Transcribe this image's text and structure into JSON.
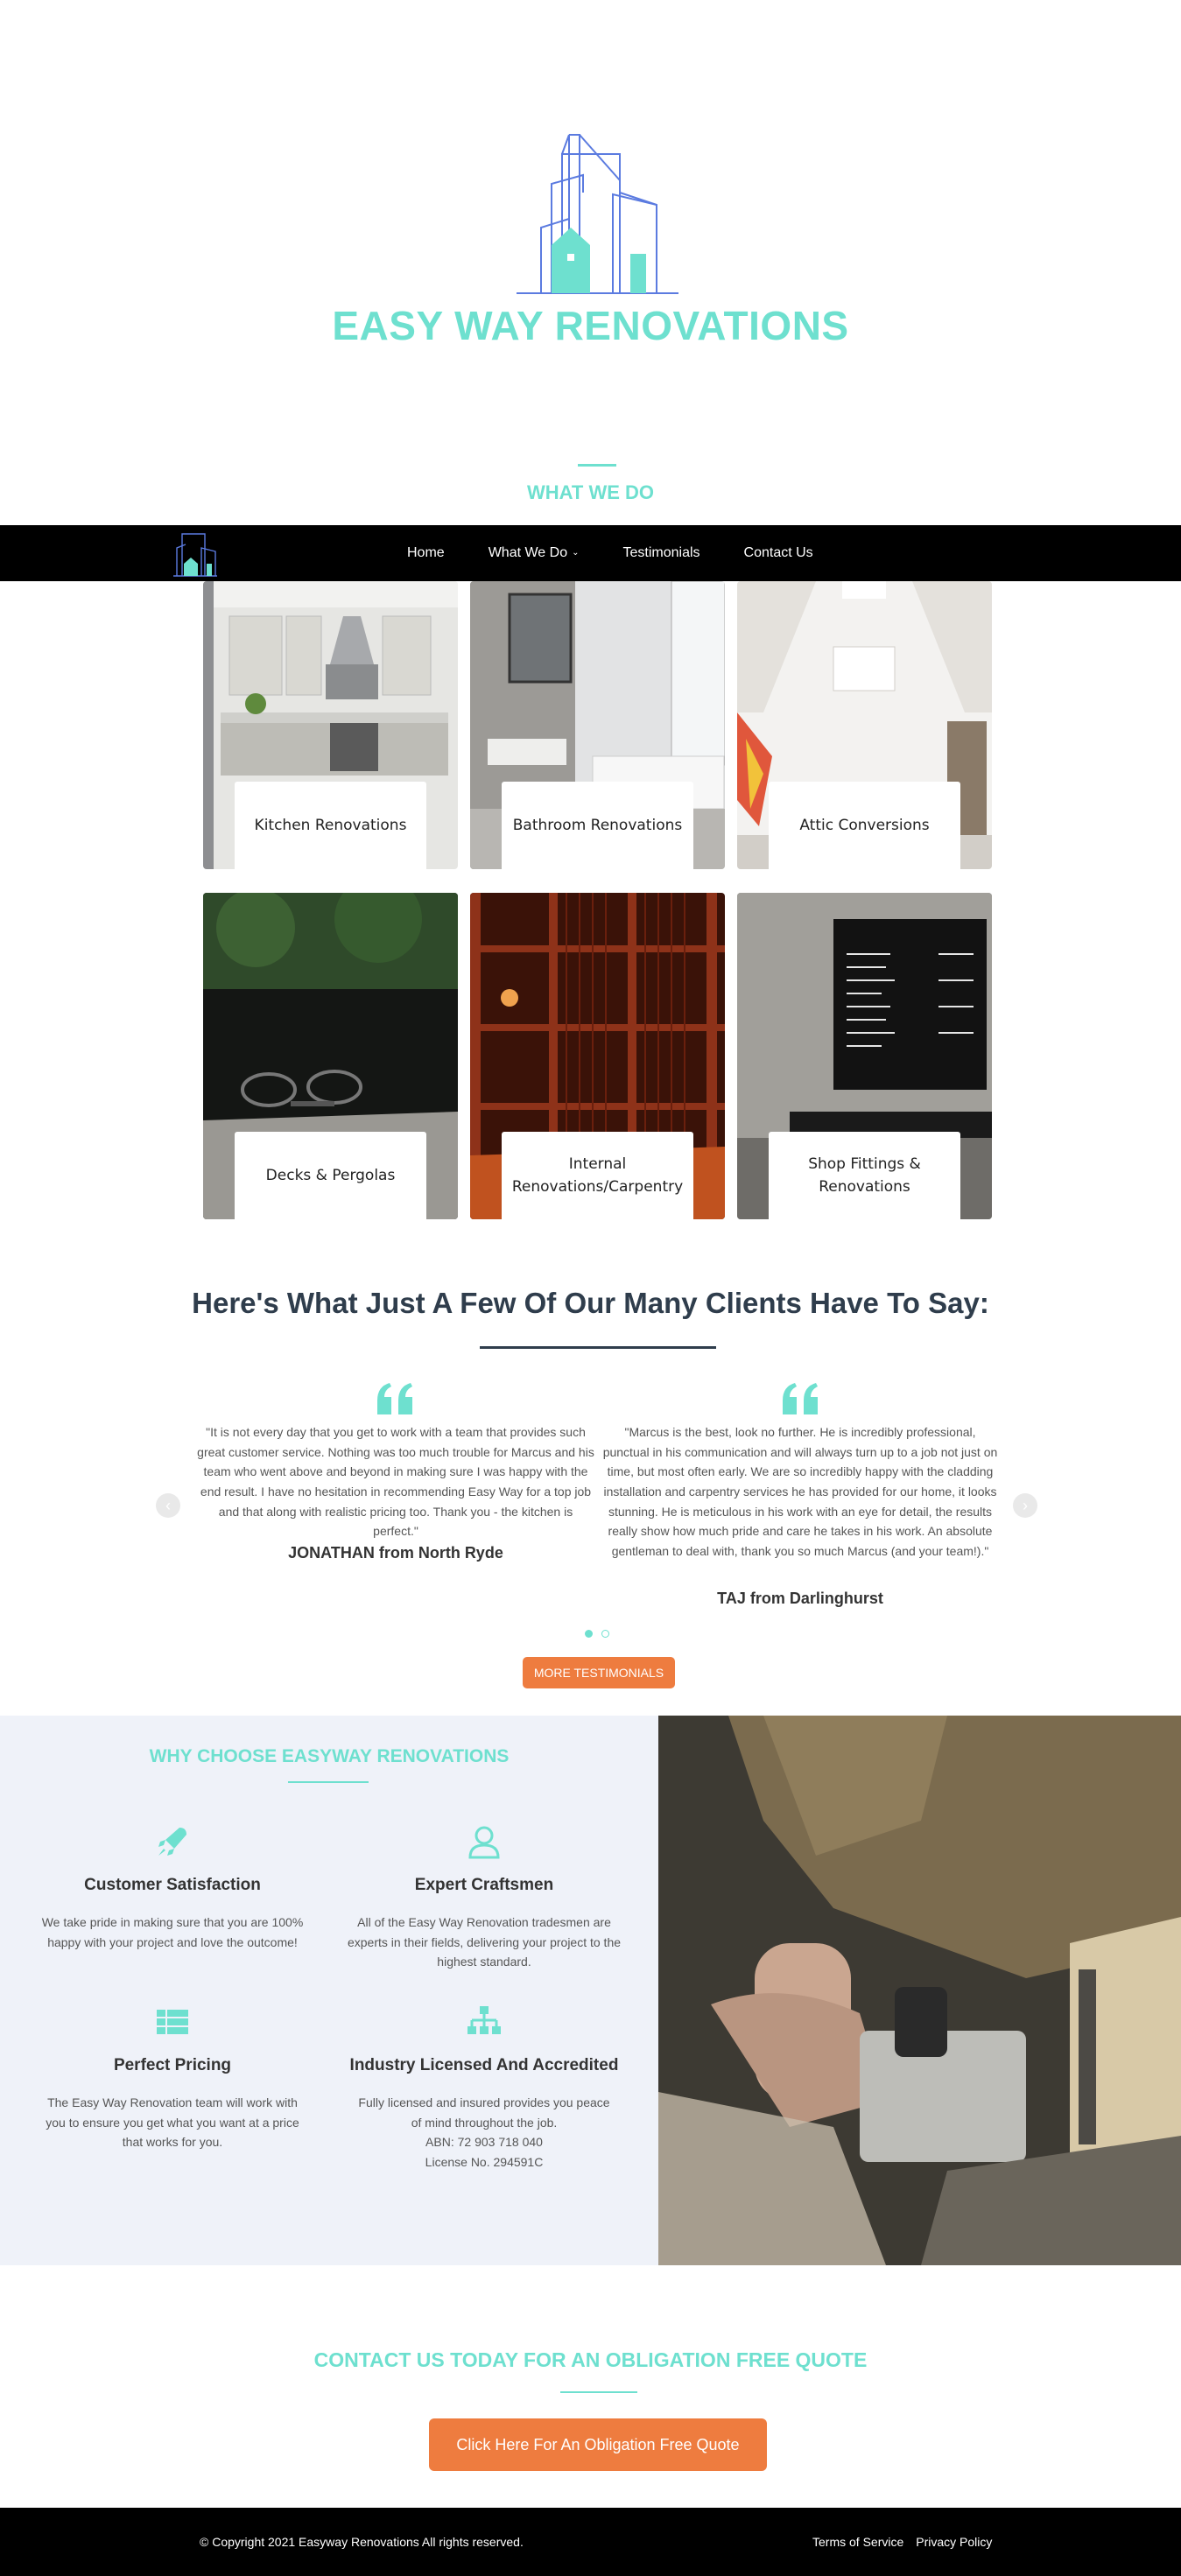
{
  "brand": {
    "name": "EASY WAY RENOVATIONS",
    "accent_color": "#6ee0cf",
    "cta_color": "#ee7c3f",
    "logo_icon": "building-house-logo-icon"
  },
  "sections": {
    "what_we_do_title": "WHAT WE DO"
  },
  "nav": {
    "items": [
      {
        "label": "Home"
      },
      {
        "label": "What We Do",
        "has_dropdown": true
      },
      {
        "label": "Testimonials"
      },
      {
        "label": "Contact Us"
      }
    ]
  },
  "services": [
    {
      "label": "Kitchen Renovations"
    },
    {
      "label": "Bathroom Renovations"
    },
    {
      "label": "Attic Conversions"
    },
    {
      "label": "Decks & Pergolas"
    },
    {
      "label": "Internal Renovations/Carpentry"
    },
    {
      "label": "Shop Fittings & Renovations"
    }
  ],
  "testimonials": {
    "heading": "Here's What Just A Few Of Our Many Clients Have To Say:",
    "items": [
      {
        "text": "\"It is not every day that you get to work with a team that provides such great customer service. Nothing was too much trouble for Marcus and his team who went above and beyond in making sure I was happy with the end result. I have no hesitation in recommending Easy Way for a top job and that along with realistic pricing too. Thank you - the kitchen is perfect.\"",
        "author": "JONATHAN from North Ryde"
      },
      {
        "text": "\"Marcus is the best, look no further. He is incredibly professional, punctual in his communication and will always turn up to a job not just on time, but most often early. We are so incredibly happy with the cladding installation and carpentry services he has provided for our home, it looks stunning. He is meticulous in his work with an eye for detail, the results really show how much pride and care he takes in his work. An absolute gentleman to deal with, thank you so much Marcus (and your team!).\"",
        "author": "TAJ from Darlinghurst"
      }
    ],
    "more_button": "MORE TESTIMONIALS",
    "pager": {
      "active": 1,
      "total": 2
    }
  },
  "why": {
    "title": "WHY CHOOSE EASYWAY RENOVATIONS",
    "features": [
      {
        "icon": "rocket-icon",
        "title": "Customer Satisfaction",
        "text": "We take pride in making sure that you are 100% happy with your project and love the outcome!"
      },
      {
        "icon": "user-icon",
        "title": "Expert Craftsmen",
        "text": "All of the Easy Way Renovation tradesmen are experts in their fields, delivering your project to the highest standard."
      },
      {
        "icon": "list-icon",
        "title": "Perfect Pricing",
        "text": "The Easy Way Renovation team will work with you to ensure you get what you want at a price that works for you."
      },
      {
        "icon": "sitemap-icon",
        "title": "Industry Licensed And Accredited",
        "text": "Fully licensed and insured provides you peace of mind throughout the job.",
        "abn": "ABN: 72 903 718 040",
        "license": "License No. 294591C"
      }
    ]
  },
  "cta": {
    "title": "CONTACT US TODAY FOR AN OBLIGATION FREE QUOTE",
    "button": "Click Here For An Obligation  Free Quote"
  },
  "footer": {
    "copyright": "© Copyright 2021 Easyway Renovations  All rights reserved.",
    "links": [
      "Terms of Service",
      "Privacy Policy"
    ]
  }
}
